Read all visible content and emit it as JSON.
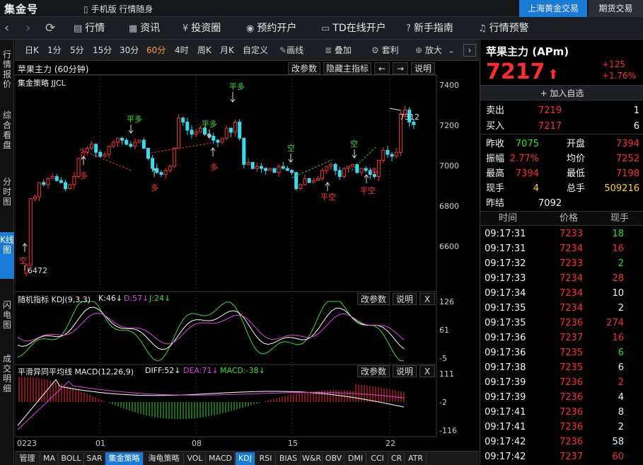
{
  "titlebar": {
    "logo": "集金号",
    "mobile_label": "手机版  行情随身",
    "tabs": [
      "上海黄金交易",
      "期货交易"
    ]
  },
  "navbar": {
    "items": [
      {
        "label": "行情",
        "icon": "chart-icon"
      },
      {
        "label": "资讯",
        "icon": "news-icon"
      },
      {
        "label": "投资圈",
        "icon": "coin-icon"
      },
      {
        "label": "预约开户",
        "icon": "location-icon"
      },
      {
        "label": "TD在线开户",
        "icon": "card-icon"
      },
      {
        "label": "新手指南",
        "icon": "help-icon"
      },
      {
        "label": "行情预警",
        "icon": "bell-icon"
      }
    ]
  },
  "sidebar": {
    "items": [
      "行情报价",
      "综合看盘",
      "分时图",
      "K线图",
      "闪电图",
      "成交明细"
    ]
  },
  "toolbar": {
    "items": [
      "日K",
      "1分",
      "5分",
      "15分",
      "30分",
      "60分",
      "4时",
      "周K",
      "月K",
      "自定义",
      "画线",
      "叠加",
      "套利",
      "放大"
    ],
    "active": "60分"
  },
  "main_panel": {
    "title": "苹果主力 (60分钟)",
    "strategy": "集金策略 JJCL",
    "buttons": [
      "改参数",
      "隐藏主指标",
      "←",
      "→",
      "说明"
    ],
    "y_ticks": [
      "7400",
      "7200",
      "7000",
      "6800",
      "6600"
    ],
    "annotations": {
      "low_label": "6472",
      "high_label": "7312",
      "signals": [
        "平多",
        "平多",
        "平多",
        "空",
        "空",
        "多",
        "多",
        "多",
        "平空",
        "平空",
        "多",
        "空"
      ]
    }
  },
  "kdj_panel": {
    "title": "随机指标 KDJ(9,3,3)",
    "k": "K:46↓",
    "d": "D:57↓",
    "j": "J:24↓",
    "buttons": [
      "改参数",
      "说明",
      "X"
    ],
    "y_ticks": [
      "126",
      "61",
      "-5"
    ]
  },
  "macd_panel": {
    "title": "平滑异同平均线 MACD(12,26,9)",
    "diff": "DIFF:52↓",
    "dea": "DEA:71↓",
    "macd": "MACD:-38↓",
    "buttons": [
      "改参数",
      "说明",
      "X"
    ],
    "y_ticks": [
      "111",
      "-2",
      "-116"
    ]
  },
  "x_axis": [
    "0223",
    "01",
    "08",
    "15",
    "22"
  ],
  "bottom_tabs": {
    "items": [
      "管理",
      "MA",
      "BOLL",
      "SAR",
      "集金策略",
      "海龟策略",
      "VOL",
      "MACD",
      "KDJ",
      "RSI",
      "BIAS",
      "W&R",
      "OBV",
      "DMI",
      "CCI",
      "CR",
      "ATR"
    ],
    "active": [
      "集金策略",
      "KDJ"
    ]
  },
  "quote": {
    "name": "苹果主力 (APm)",
    "price": "7217",
    "change": "+125",
    "change_pct": "+1.76%",
    "add_watch": "+ 加入自选",
    "sell_label": "卖出",
    "sell_price": "7219",
    "sell_vol": "1",
    "buy_label": "买入",
    "buy_price": "7217",
    "buy_vol": "6",
    "stats": [
      {
        "l1": "昨收",
        "v1": "7075",
        "l2": "开盘",
        "v2": "7394"
      },
      {
        "l1": "振幅",
        "v1": "2.77%",
        "l2": "均价",
        "v2": "7252"
      },
      {
        "l1": "最高",
        "v1": "7394",
        "l2": "最低",
        "v2": "7198"
      },
      {
        "l1": "现手",
        "v1": "4",
        "l2": "总手",
        "v2": "509216"
      }
    ],
    "settle_label": "昨结",
    "settle_value": "7092",
    "trade_headers": [
      "时间",
      "价格",
      "现手"
    ],
    "trades": [
      {
        "t": "09:17:31",
        "p": "7233",
        "v": "18",
        "c": "green"
      },
      {
        "t": "09:17:31",
        "p": "7234",
        "v": "16",
        "c": "red"
      },
      {
        "t": "09:17:32",
        "p": "7233",
        "v": "2",
        "c": "green"
      },
      {
        "t": "09:17:33",
        "p": "7234",
        "v": "28",
        "c": "red"
      },
      {
        "t": "09:17:34",
        "p": "7234",
        "v": "10",
        "c": "white"
      },
      {
        "t": "09:17:35",
        "p": "7234",
        "v": "2",
        "c": "white"
      },
      {
        "t": "09:17:35",
        "p": "7236",
        "v": "274",
        "c": "red"
      },
      {
        "t": "09:17:36",
        "p": "7237",
        "v": "16",
        "c": "red"
      },
      {
        "t": "09:17:36",
        "p": "7235",
        "v": "6",
        "c": "green"
      },
      {
        "t": "09:17:38",
        "p": "7235",
        "v": "6",
        "c": "white"
      },
      {
        "t": "09:17:39",
        "p": "7236",
        "v": "2",
        "c": "red"
      },
      {
        "t": "09:17:39",
        "p": "7236",
        "v": "4",
        "c": "white"
      },
      {
        "t": "09:17:41",
        "p": "7236",
        "v": "8",
        "c": "white"
      },
      {
        "t": "09:17:41",
        "p": "7236",
        "v": "2",
        "c": "white"
      },
      {
        "t": "09:17:42",
        "p": "7236",
        "v": "58",
        "c": "white"
      },
      {
        "t": "09:17:42",
        "p": "7237",
        "v": "60",
        "c": "red"
      }
    ]
  }
}
